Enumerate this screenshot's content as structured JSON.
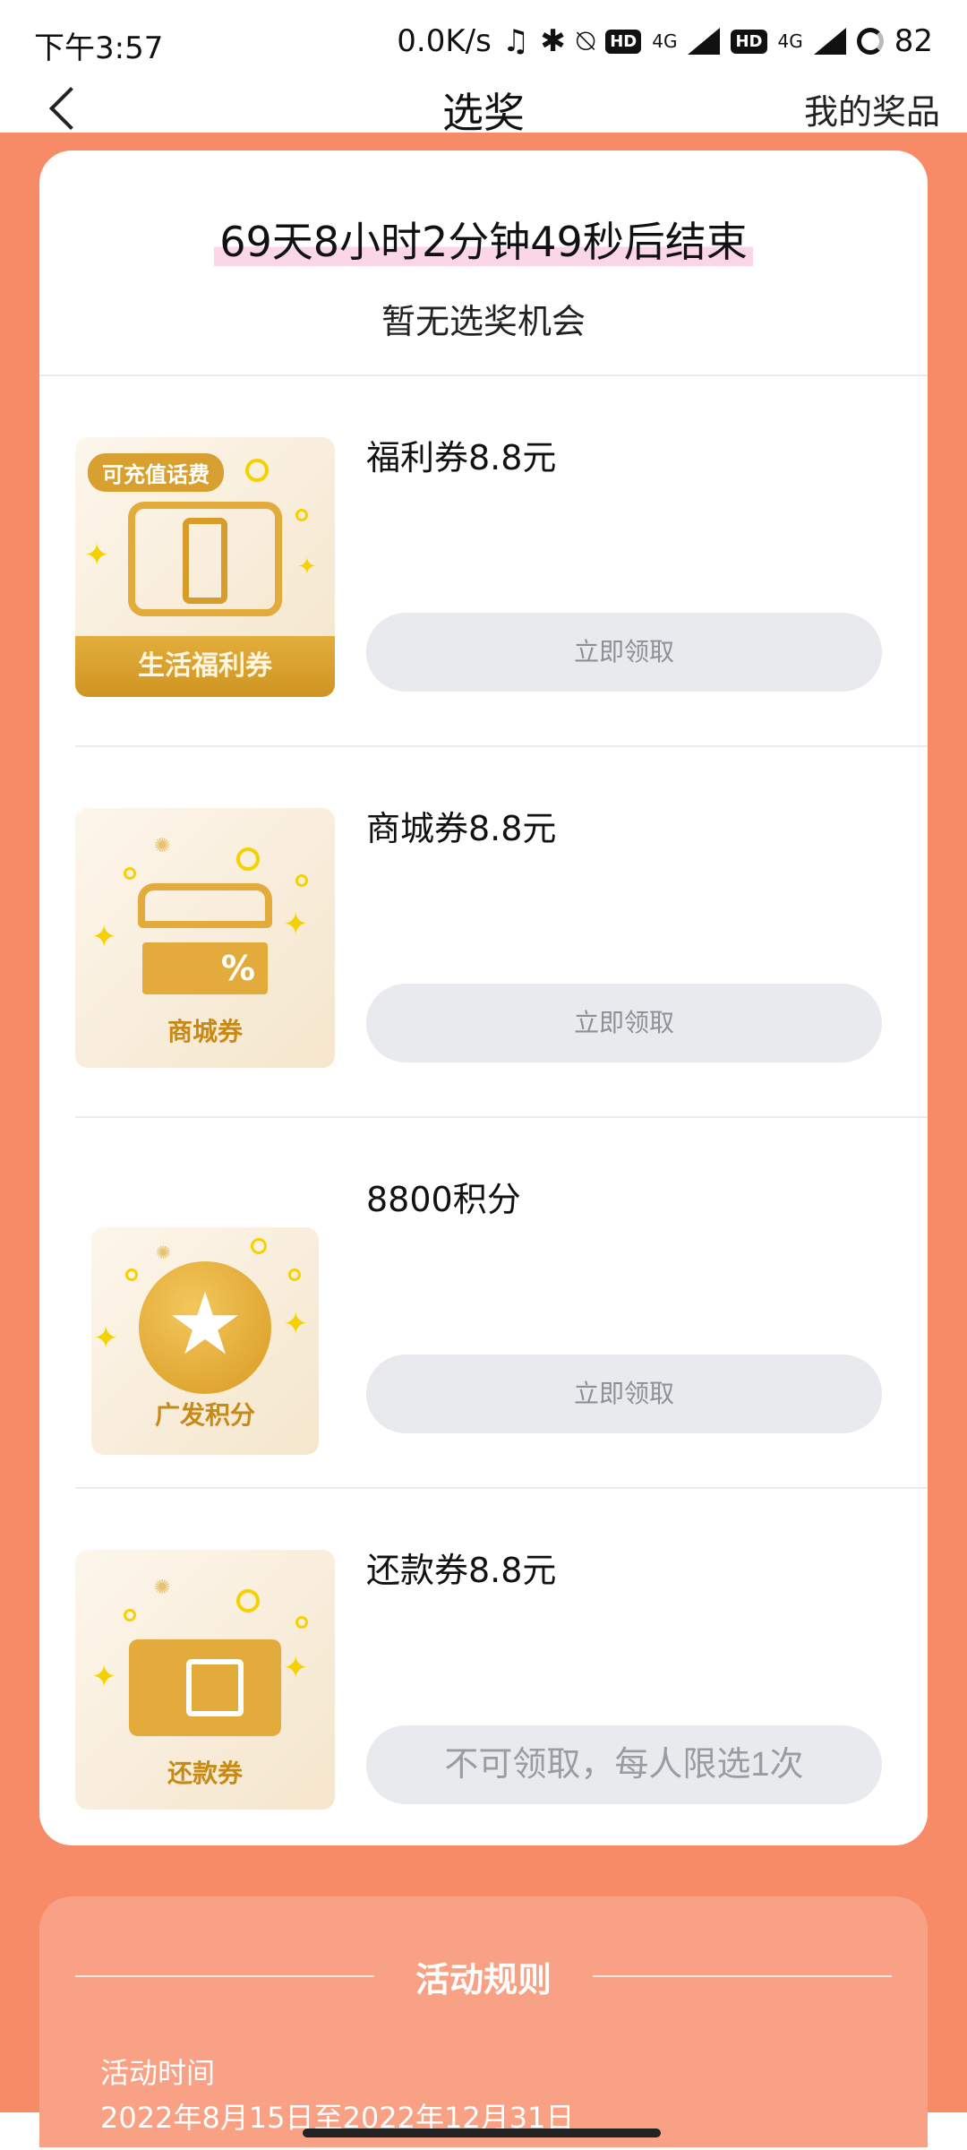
{
  "status_bar": {
    "time": "下午3:57",
    "net_speed": "0.0K/s",
    "hd_label": "HD",
    "network_label": "4G",
    "battery": "82"
  },
  "nav": {
    "title": "选奖",
    "right_action": "我的奖品"
  },
  "header": {
    "countdown": "69天8小时2分钟49秒后结束",
    "chance_text": "暂无选奖机会"
  },
  "prizes": [
    {
      "name": "福利券8.8元",
      "thumb_tag": "可充值话费",
      "thumb_caption": "生活福利券",
      "button": "立即领取"
    },
    {
      "name": "商城券8.8元",
      "thumb_caption": "商城券",
      "button": "立即领取"
    },
    {
      "name": "8800积分",
      "thumb_caption": "广发积分",
      "button": "立即领取"
    },
    {
      "name": "还款券8.8元",
      "thumb_caption": "还款券",
      "button": "不可领取，每人限选1次"
    }
  ],
  "rules": {
    "title": "活动规则",
    "time_label": "活动时间",
    "time_value": "2022年8月15日至2022年12月31日"
  },
  "colors": {
    "page_orange": "#f78a67",
    "rules_panel": "#f9a184",
    "button_disabled": "#e9eaee",
    "gold": "#e2ab3c",
    "sparkle_yellow": "#f6d100"
  },
  "icons": [
    "back-chevron-icon",
    "phone-recharge-icon",
    "store-icon",
    "star-coin-icon",
    "repayment-ticket-icon"
  ]
}
